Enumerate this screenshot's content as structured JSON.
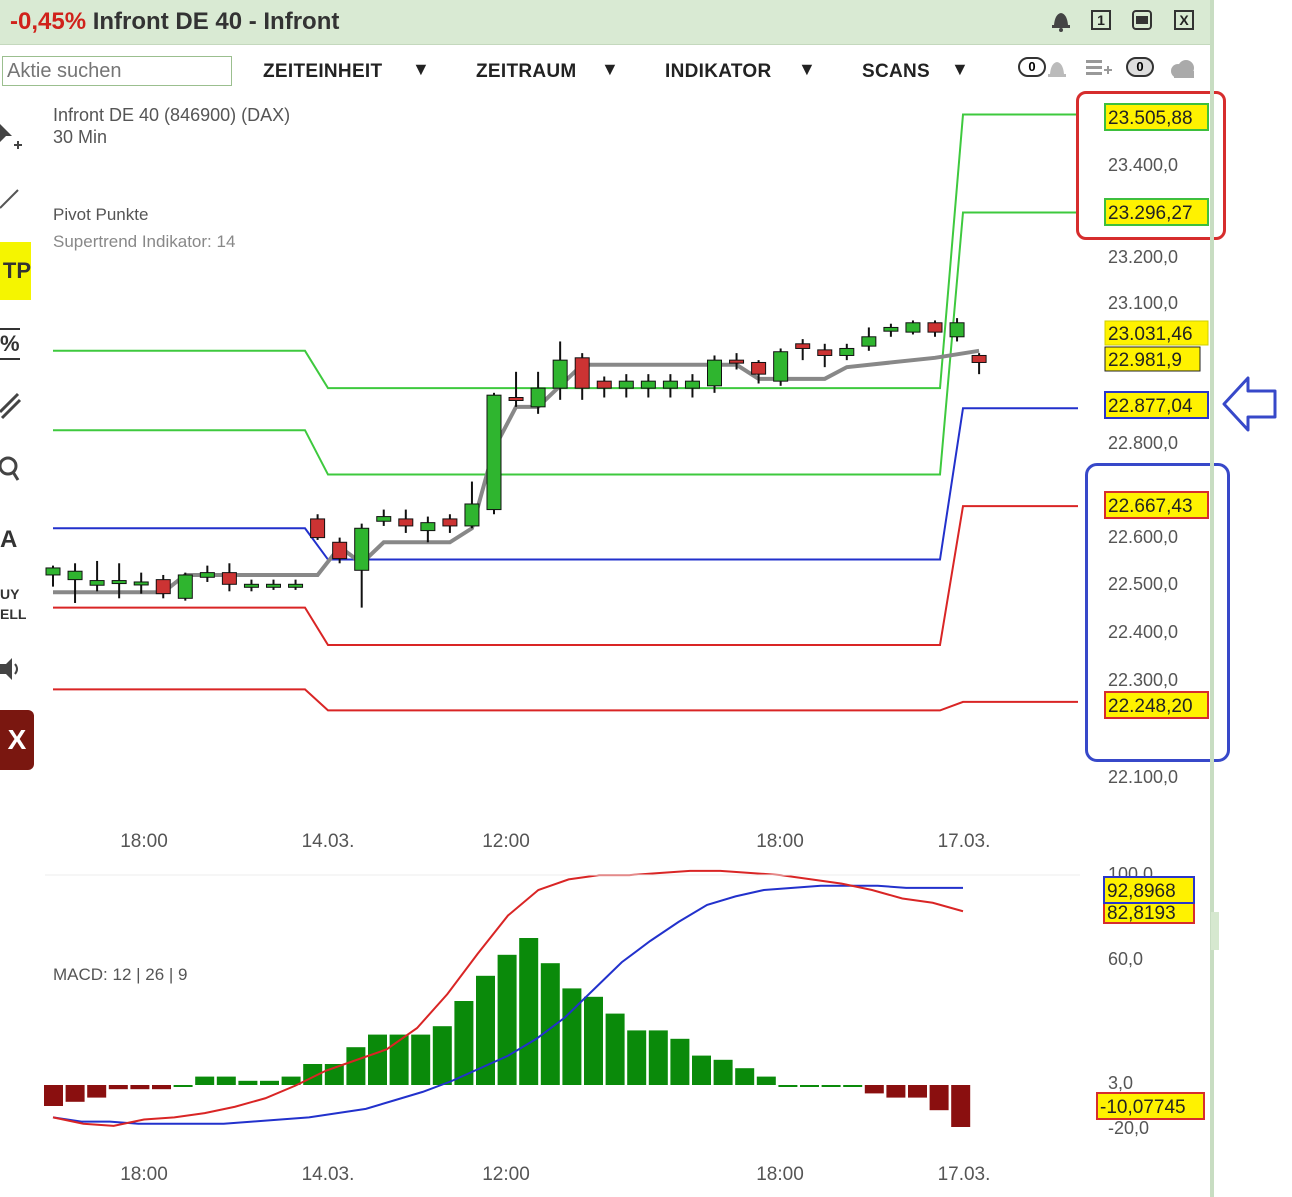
{
  "window": {
    "change": "-0,45%",
    "title": "Infront DE 40 - Infront",
    "buttons": [
      "1",
      "X"
    ]
  },
  "toolbar": {
    "search_placeholder": "Aktie suchen",
    "menus": [
      "ZEITEINHEIT",
      "ZEITRAUM",
      "INDIKATOR",
      "SCANS"
    ],
    "alert_count": "0",
    "portfolio_count": "0"
  },
  "left_tools": [
    "TP",
    "%",
    "A",
    "UY",
    "ELL",
    "X"
  ],
  "main_chart": {
    "instrument": "Infront DE 40 (846900) (DAX)",
    "interval": "30 Min",
    "indicator1": "Pivot Punkte",
    "indicator2": "Supertrend Indikator: 14",
    "y_axis": [
      "23.400,0",
      "23.200,0",
      "23.100,0",
      "22.800,0",
      "22.600,0",
      "22.500,0",
      "22.400,0",
      "22.300,0",
      "22.100,0"
    ],
    "price_labels": [
      {
        "text": "23.505,88",
        "color": "green"
      },
      {
        "text": "23.296,27",
        "color": "green"
      },
      {
        "text": "23.031,46",
        "color": "yellow"
      },
      {
        "text": "22.981,9",
        "color": "yellow"
      },
      {
        "text": "22.877,04",
        "color": "blue"
      },
      {
        "text": "22.667,43",
        "color": "red"
      },
      {
        "text": "22.248,20",
        "color": "red"
      }
    ],
    "x_axis": [
      "18:00",
      "14.03.",
      "12:00",
      "18:00",
      "17.03."
    ]
  },
  "macd": {
    "label": "MACD: 12 | 26 | 9",
    "y_axis": [
      "100,0",
      "60,0",
      "3,0",
      "-20,0"
    ],
    "value_labels": [
      {
        "text": "92,8968",
        "color": "blue"
      },
      {
        "text": "82,8193",
        "color": "red"
      },
      {
        "text": "-10,07745",
        "color": "red"
      }
    ],
    "x_axis": [
      "18:00",
      "14.03.",
      "12:00",
      "18:00",
      "17.03."
    ]
  },
  "chart_data": [
    {
      "type": "candlestick",
      "title": "Infront DE 40 (846900) (DAX)",
      "ylim": [
        22050,
        23560
      ],
      "candles": [
        [
          22520,
          22535,
          22495,
          22540
        ],
        [
          22510,
          22528,
          22460,
          22545
        ],
        [
          22498,
          22508,
          22485,
          22550
        ],
        [
          22505,
          22508,
          22470,
          22545
        ],
        [
          22505,
          22505,
          22480,
          22525
        ],
        [
          22510,
          22480,
          22470,
          22520
        ],
        [
          22470,
          22520,
          22465,
          22525
        ],
        [
          22515,
          22525,
          22505,
          22540
        ],
        [
          22525,
          22500,
          22485,
          22545
        ],
        [
          22495,
          22500,
          22485,
          22510
        ],
        [
          22498,
          22500,
          22488,
          22510
        ],
        [
          22498,
          22500,
          22488,
          22510
        ],
        [
          22640,
          22600,
          22595,
          22650
        ],
        [
          22590,
          22555,
          22545,
          22600
        ],
        [
          22530,
          22620,
          22450,
          22630
        ],
        [
          22635,
          22645,
          22625,
          22660
        ],
        [
          22640,
          22625,
          22610,
          22660
        ],
        [
          22615,
          22632,
          22590,
          22645
        ],
        [
          22640,
          22625,
          22610,
          22650
        ],
        [
          22625,
          22672,
          22620,
          22720
        ],
        [
          22660,
          22905,
          22650,
          22910
        ],
        [
          22900,
          22895,
          22880,
          22955
        ],
        [
          22880,
          22920,
          22865,
          22955
        ],
        [
          22920,
          22980,
          22895,
          23020
        ],
        [
          22985,
          22920,
          22895,
          22995
        ],
        [
          22935,
          22920,
          22900,
          22945
        ],
        [
          22920,
          22935,
          22900,
          22950
        ],
        [
          22920,
          22935,
          22900,
          22950
        ],
        [
          22920,
          22935,
          22900,
          22950
        ],
        [
          22920,
          22935,
          22900,
          22950
        ],
        [
          22925,
          22980,
          22910,
          22990
        ],
        [
          22980,
          22975,
          22960,
          22995
        ],
        [
          22975,
          22950,
          22930,
          22980
        ],
        [
          22935,
          22998,
          22925,
          23005
        ],
        [
          23015,
          23005,
          22980,
          23025
        ],
        [
          23002,
          22990,
          22965,
          23015
        ],
        [
          22990,
          23005,
          22980,
          23015
        ],
        [
          23010,
          23030,
          23000,
          23050
        ],
        [
          23042,
          23050,
          23030,
          23058
        ],
        [
          23040,
          23060,
          23035,
          23065
        ],
        [
          23060,
          23040,
          23030,
          23065
        ],
        [
          23030,
          23060,
          23020,
          23070
        ],
        [
          22990,
          22975,
          22950,
          22995
        ]
      ],
      "supertrend": [
        [
          0,
          22483
        ],
        [
          5,
          22483
        ],
        [
          6,
          22520
        ],
        [
          12,
          22520
        ],
        [
          13,
          22580
        ],
        [
          14,
          22545
        ],
        [
          15,
          22590
        ],
        [
          18,
          22590
        ],
        [
          19,
          22620
        ],
        [
          20,
          22790
        ],
        [
          21,
          22880
        ],
        [
          22,
          22880
        ],
        [
          24,
          22970
        ],
        [
          31,
          22970
        ],
        [
          32,
          22940
        ],
        [
          35,
          22940
        ],
        [
          36,
          22965
        ],
        [
          40,
          22985
        ],
        [
          42,
          23000
        ]
      ],
      "pivot_lines": [
        {
          "color": "green",
          "y_old": 23000,
          "y_mid": 22920,
          "y_new": 23505.88,
          "label": "23.505,88"
        },
        {
          "color": "green",
          "y_old": 22830,
          "y_mid": 22735,
          "y_new": 23296.27,
          "label": "23.296,27"
        },
        {
          "color": "blue",
          "y_old": 22620,
          "y_mid": 22553,
          "y_new": 22877.04,
          "label": "22.877,04"
        },
        {
          "color": "red",
          "y_old": 22450,
          "y_mid": 22370,
          "y_new": 22667.43,
          "label": "22.667,43"
        },
        {
          "color": "red",
          "y_old": 22275,
          "y_mid": 22230,
          "y_new": 22248.2,
          "label": "22.248,20"
        }
      ]
    },
    {
      "type": "bar",
      "title": "MACD: 12 | 26 | 9",
      "ylim": [
        -25,
        105
      ],
      "histogram": [
        -5,
        -4,
        -3,
        -1,
        -1,
        -1,
        0,
        2,
        2,
        1,
        1,
        2,
        5,
        5,
        9,
        12,
        12,
        12,
        14,
        20,
        26,
        31,
        35,
        29,
        23,
        21,
        17,
        13,
        13,
        11,
        7,
        6,
        4,
        2,
        0,
        0,
        0,
        0,
        -2,
        -3,
        -3,
        -6,
        -10
      ],
      "series": [
        {
          "name": "92,8968",
          "color": "blue",
          "values": [
            -15,
            -17,
            -17,
            -18,
            -18,
            -18,
            -18,
            -17,
            -16,
            -15,
            -13,
            -11,
            -7,
            -3,
            2,
            8,
            14,
            22,
            32,
            45,
            58,
            68,
            77,
            85,
            89,
            92,
            93,
            94,
            94,
            94,
            93,
            93,
            93
          ]
        },
        {
          "name": "82,8193",
          "color": "red",
          "values": [
            -15,
            -18,
            -19,
            -16,
            -15,
            -13,
            -10,
            -6,
            0,
            7,
            12,
            17,
            27,
            43,
            62,
            80,
            92,
            97,
            99,
            99,
            100,
            101,
            101,
            100,
            99,
            97,
            95,
            92,
            88,
            86,
            82
          ]
        }
      ]
    }
  ]
}
